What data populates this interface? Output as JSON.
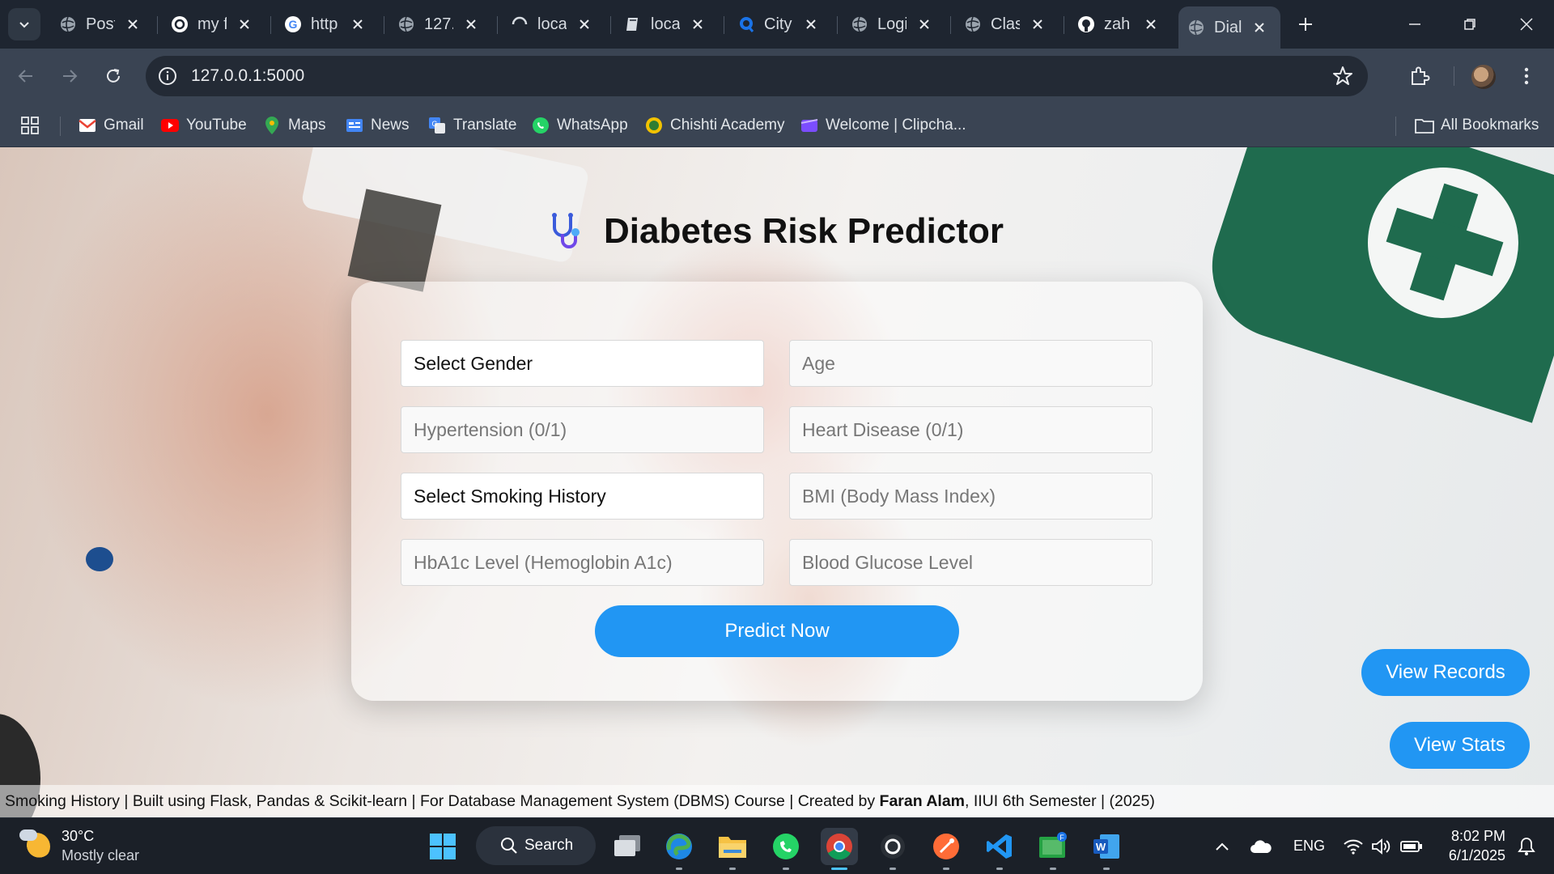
{
  "browser": {
    "tabs": [
      {
        "title": "Post",
        "icon": "globe-icon"
      },
      {
        "title": "my f",
        "icon": "openai-icon"
      },
      {
        "title": "http",
        "icon": "google-icon"
      },
      {
        "title": "127.",
        "icon": "globe-icon"
      },
      {
        "title": "loca",
        "icon": "loading-icon"
      },
      {
        "title": "loca",
        "icon": "book-icon"
      },
      {
        "title": "City",
        "icon": "app-icon"
      },
      {
        "title": "Logi",
        "icon": "globe-icon"
      },
      {
        "title": "Clas",
        "icon": "globe-icon"
      },
      {
        "title": "zah",
        "icon": "github-icon"
      },
      {
        "title": "Dial",
        "icon": "globe-icon",
        "active": true
      }
    ],
    "url": "127.0.0.1:5000",
    "bookmarks": [
      {
        "label": "Gmail",
        "icon": "gmail-icon"
      },
      {
        "label": "YouTube",
        "icon": "youtube-icon"
      },
      {
        "label": "Maps",
        "icon": "maps-icon"
      },
      {
        "label": "News",
        "icon": "news-icon"
      },
      {
        "label": "Translate",
        "icon": "translate-icon"
      },
      {
        "label": "WhatsApp",
        "icon": "whatsapp-icon"
      },
      {
        "label": "Chishti Academy",
        "icon": "academy-icon"
      },
      {
        "label": "Welcome | Clipcha...",
        "icon": "clipchamp-icon"
      }
    ],
    "all_bookmarks": "All Bookmarks"
  },
  "app": {
    "title": "Diabetes Risk Predictor",
    "fields": {
      "gender": "Select Gender",
      "age": "Age",
      "hypertension": "Hypertension (0/1)",
      "heart_disease": "Heart Disease (0/1)",
      "smoking": "Select Smoking History",
      "bmi": "BMI (Body Mass Index)",
      "hba1c": "HbA1c Level (Hemoglobin A1c)",
      "glucose": "Blood Glucose Level"
    },
    "predict_button": "Predict Now",
    "view_records": "View Records",
    "view_stats": "View Stats",
    "footer": {
      "text_before": "Smoking History | Built using Flask, Pandas & Scikit-learn | For Database Management System (DBMS) Course | Created by",
      "author": "Faran Alam",
      "text_after": ", IIUI 6th Semester | (2025)"
    }
  },
  "taskbar": {
    "temperature": "30°C",
    "weather": "Mostly clear",
    "search": "Search",
    "language": "ENG",
    "time": "8:02 PM",
    "date": "6/1/2025"
  },
  "colors": {
    "accent": "#2196f3",
    "tab_bg": "#1e2530",
    "toolbar_bg": "#3a4453"
  }
}
